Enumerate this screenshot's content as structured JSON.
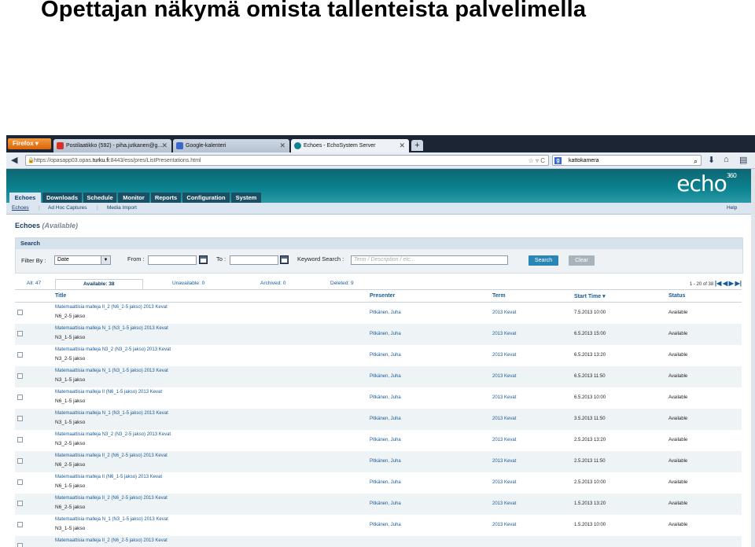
{
  "slide": {
    "title": "Opettajan näkymä omista tallenteista palvelimella"
  },
  "browser": {
    "app_button": "Firefox ▾",
    "tabs": [
      {
        "label": "Postilaatikko (592) - piha.jutkanen@g...",
        "icon": "gmail-icon",
        "color": "#d93025"
      },
      {
        "label": "Google-kalenteri",
        "icon": "calendar-icon",
        "color": "#3a67c9"
      },
      {
        "label": "Echoes - EchoSystem Server",
        "icon": "echo-icon",
        "color": "#0c8391"
      }
    ],
    "url_prefix": "https://opasapp03.opas.",
    "url_host": "turku.fi",
    "url_suffix": ":8443/ess/pres/ListPresentations.html",
    "search_value": "kattokamera"
  },
  "app": {
    "logo": "echo",
    "logo_sup": "360",
    "main_tabs": [
      "Echoes",
      "Downloads",
      "Schedule",
      "Monitor",
      "Reports",
      "Configuration",
      "System"
    ],
    "sub_tabs": [
      "Echoes",
      "Ad Hoc Captures",
      "Media Import"
    ],
    "help": "Help",
    "heading": "Echoes",
    "heading_state": "(Available)",
    "search": {
      "title": "Search",
      "filter_label": "Filter By :",
      "filter_value": "Date",
      "from_label": "From :",
      "to_label": "To :",
      "keyword_label": "Keyword Search :",
      "keyword_placeholder": "Term / Description / etc...",
      "search_btn": "Search",
      "clear_btn": "Clear"
    },
    "status_tabs": [
      "All: 47",
      "Available: 38",
      "Unavailable: 0",
      "Archived: 0",
      "Deleted: 9"
    ],
    "pager": "1 - 20 of 38",
    "columns": {
      "title": "Title",
      "presenter": "Presenter",
      "term": "Term",
      "start": "Start Time",
      "status": "Status"
    },
    "rows": [
      {
        "t1": "Matemaattisia malleja II_2 (N6_2-5 jakso) 2013 Kevat",
        "t2": "N6_2-5 jakso",
        "presenter": "Pitkänen, Juha",
        "term": "2013 Kevat",
        "start": "7.5.2013 10:00",
        "status": "Available"
      },
      {
        "t1": "Matemaattisia malleja N_1 (N3_1-5 jakso) 2013 Kevat",
        "t2": "N3_1-5 jakso",
        "presenter": "Pitkänen, Juha",
        "term": "2013 Kevat",
        "start": "6.5.2013 15:00",
        "status": "Available"
      },
      {
        "t1": "Matemaattisia malleja N3_2 (N3_2-5 jakso) 2013 Kevat",
        "t2": "N3_2-5 jakso",
        "presenter": "Pitkänen, Juha",
        "term": "2013 Kevat",
        "start": "6.5.2013 13:20",
        "status": "Available"
      },
      {
        "t1": "Matemaattisia malleja N_1 (N3_1-5 jakso) 2013 Kevat",
        "t2": "N3_1-5 jakso",
        "presenter": "Pitkänen, Juha",
        "term": "2013 Kevat",
        "start": "6.5.2013 11:50",
        "status": "Available"
      },
      {
        "t1": "Matemaattisia malleja II (N6_1-5 jakso) 2013 Kevat",
        "t2": "N6_1-5 jakso",
        "presenter": "Pitkänen, Juha",
        "term": "2013 Kevat",
        "start": "6.5.2013 10:00",
        "status": "Available"
      },
      {
        "t1": "Matemaattisia malleja N_1 (N3_1-5 jakso) 2013 Kevat",
        "t2": "N3_1-5 jakso",
        "presenter": "Pitkänen, Juha",
        "term": "2013 Kevat",
        "start": "3.5.2013 11:50",
        "status": "Available"
      },
      {
        "t1": "Matemaattisia malleja N3_2 (N3_2-5 jakso) 2013 Kevat",
        "t2": "N3_2-5 jakso",
        "presenter": "Pitkänen, Juha",
        "term": "2013 Kevat",
        "start": "2.5.2013 13:20",
        "status": "Available"
      },
      {
        "t1": "Matemaattisia malleja II_2 (N6_2-5 jakso) 2013 Kevat",
        "t2": "N6_2-5 jakso",
        "presenter": "Pitkänen, Juha",
        "term": "2013 Kevat",
        "start": "2.5.2013 11:50",
        "status": "Available"
      },
      {
        "t1": "Matemaattisia malleja II (N6_1-5 jakso) 2013 Kevat",
        "t2": "N6_1-5 jakso",
        "presenter": "Pitkänen, Juha",
        "term": "2013 Kevat",
        "start": "2.5.2013 10:00",
        "status": "Available"
      },
      {
        "t1": "Matemaattisia malleja II_2 (N6_2-5 jakso) 2013 Kevat",
        "t2": "N6_2-5 jakso",
        "presenter": "Pitkänen, Juha",
        "term": "2013 Kevat",
        "start": "1.5.2013 13:20",
        "status": "Available"
      },
      {
        "t1": "Matemaattisia malleja N_1 (N3_1-5 jakso) 2013 Kevat",
        "t2": "N3_1-5 jakso",
        "presenter": "Pitkänen, Juha",
        "term": "2013 Kevat",
        "start": "1.5.2013 10:00",
        "status": "Available"
      },
      {
        "t1": "Matemaattisia malleja II_2 (N6_2-5 jakso) 2013 Kevat",
        "t2": "",
        "presenter": "",
        "term": "",
        "start": "",
        "status": ""
      }
    ]
  }
}
